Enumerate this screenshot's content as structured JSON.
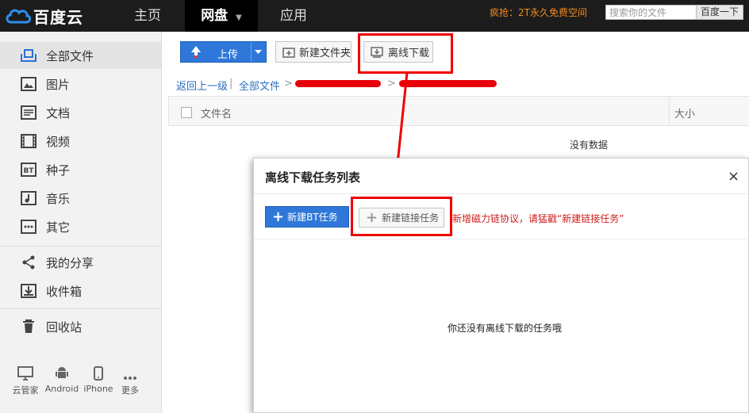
{
  "top_nav": {
    "logo_text": "百度云",
    "tabs": [
      {
        "label": "主页"
      },
      {
        "label": "网盘"
      },
      {
        "label": "应用"
      }
    ],
    "promo": "疯抢：2T永久免费空间",
    "search_placeholder": "搜索你的文件",
    "search_button": "百度一下"
  },
  "sidebar": {
    "items": [
      {
        "label": "全部文件",
        "icon": "all-files-icon"
      },
      {
        "label": "图片",
        "icon": "image-icon"
      },
      {
        "label": "文档",
        "icon": "document-icon"
      },
      {
        "label": "视频",
        "icon": "video-icon"
      },
      {
        "label": "种子",
        "icon": "bt-icon"
      },
      {
        "label": "音乐",
        "icon": "music-icon"
      },
      {
        "label": "其它",
        "icon": "more-dots-icon"
      },
      {
        "label": "我的分享",
        "icon": "share-icon"
      },
      {
        "label": "收件箱",
        "icon": "inbox-icon"
      },
      {
        "label": "回收站",
        "icon": "trash-icon"
      }
    ],
    "devices": [
      {
        "label": "云管家",
        "icon": "monitor-icon"
      },
      {
        "label": "Android",
        "icon": "android-icon"
      },
      {
        "label": "iPhone",
        "icon": "phone-icon"
      },
      {
        "label": "更多",
        "icon": "ellipsis-icon"
      }
    ]
  },
  "toolbar": {
    "upload": "上传",
    "new_folder": "新建文件夹",
    "offline_download": "离线下载"
  },
  "breadcrumb": {
    "back": "返回上一级",
    "root": "全部文件"
  },
  "table": {
    "col_name": "文件名",
    "col_size": "大小",
    "empty": "没有数据"
  },
  "dialog": {
    "title": "离线下载任务列表",
    "close": "×",
    "new_bt": "新建BT任务",
    "new_link": "新建链接任务",
    "hint": "新增磁力链协议，请猛戳“新建链接任务”",
    "empty": "你还没有离线下载的任务哦"
  },
  "colors": {
    "topbar": "#1c1c1c",
    "primary_blue": "#2f78d9",
    "highlight_red": "#e00000",
    "promo_orange": "#f08a24"
  }
}
